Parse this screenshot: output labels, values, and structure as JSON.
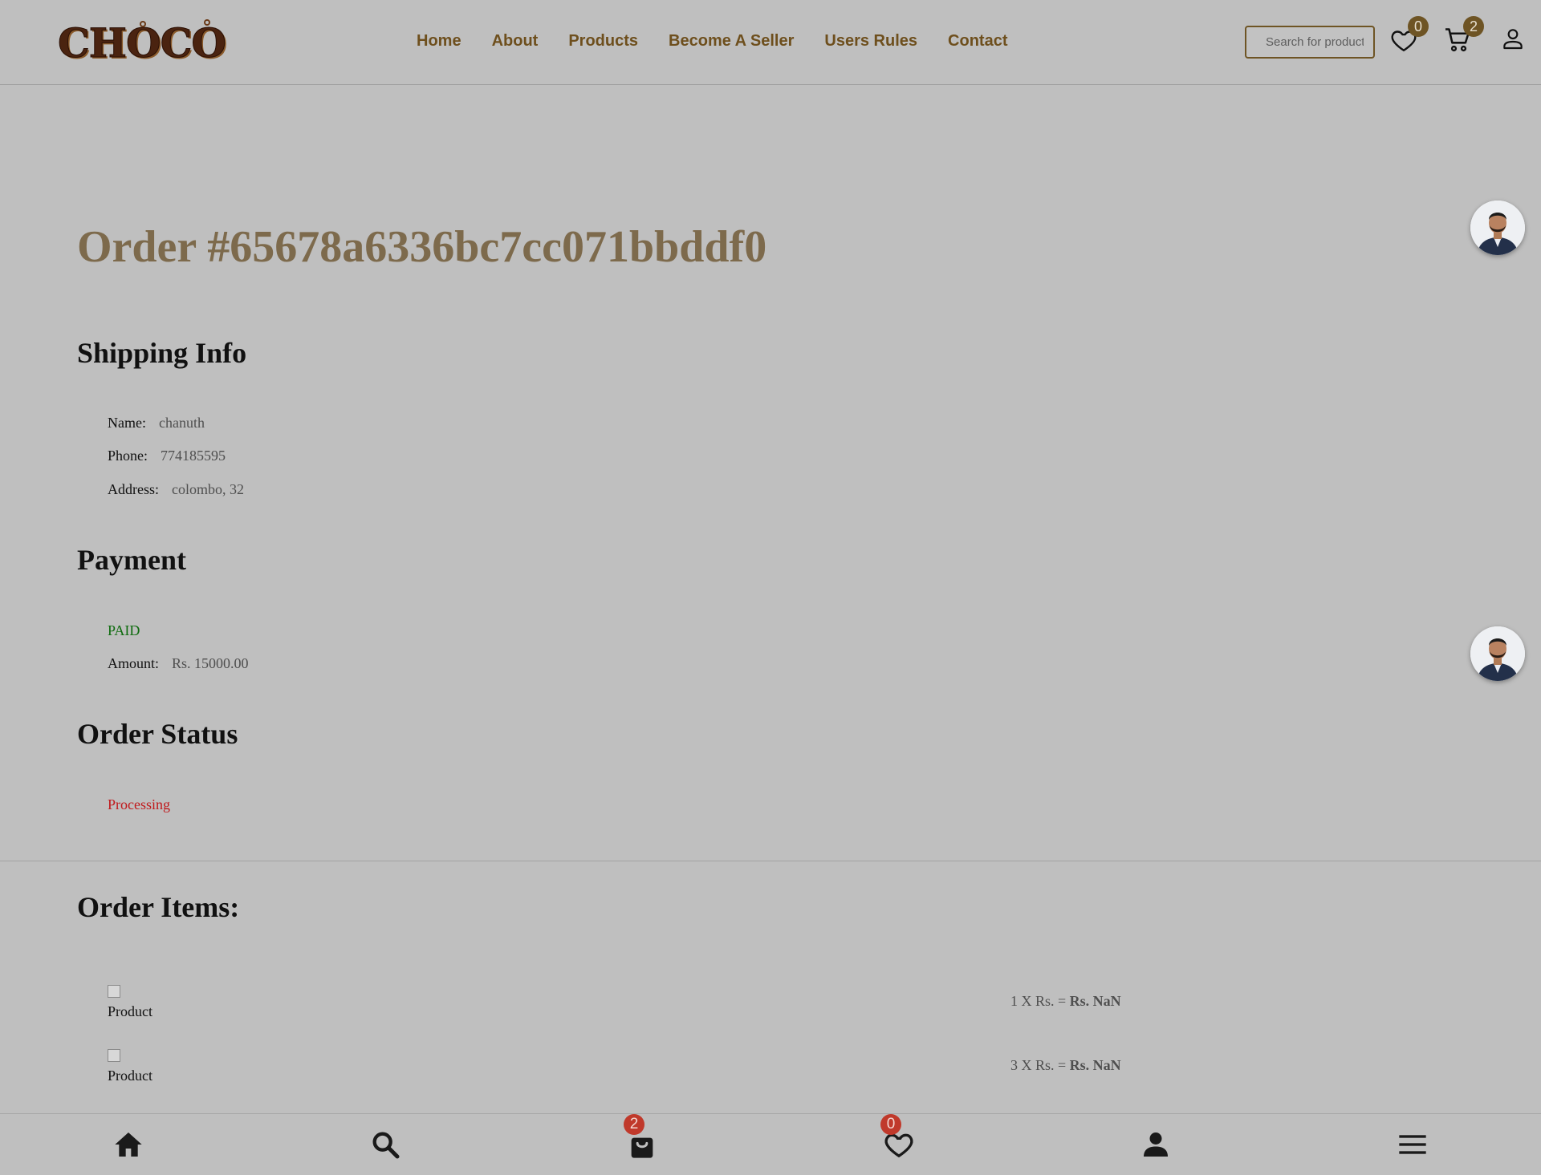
{
  "header": {
    "logo_text": "CHOCO",
    "nav": [
      "Home",
      "About",
      "Products",
      "Become A Seller",
      "Users Rules",
      "Contact"
    ],
    "search_placeholder": "Search for products",
    "wishlist_count": "0",
    "cart_count": "2",
    "icons": [
      "heart-icon",
      "cart-icon",
      "user-icon"
    ]
  },
  "order": {
    "title": "Order #65678a6336bc7cc071bbddf0"
  },
  "shipping": {
    "title": "Shipping Info",
    "name_label": "Name:",
    "name_value": "chanuth",
    "phone_label": "Phone:",
    "phone_value": "774185595",
    "address_label": "Address:",
    "address_value": "colombo, 32"
  },
  "payment": {
    "title": "Payment",
    "status": "PAID",
    "amount_label": "Amount:",
    "amount_value": "Rs. 15000.00"
  },
  "order_status": {
    "title": "Order Status",
    "value": "Processing"
  },
  "order_items": {
    "title": "Order Items:",
    "items": [
      {
        "img_alt": "Product",
        "qty_text": "1 X Rs. = ",
        "total": "Rs. NaN"
      },
      {
        "img_alt": "Product",
        "qty_text": "3 X Rs. = ",
        "total": "Rs. NaN"
      }
    ]
  },
  "bottom_bar": {
    "cart_count": "2",
    "wishlist_count": "0",
    "icons": [
      "home-icon",
      "search-icon",
      "shopping-bag-icon",
      "heart-icon",
      "person-icon",
      "menu-icon"
    ]
  },
  "colors": {
    "accent": "#6e4f1d",
    "title": "#7d6a4c",
    "paid": "#0e6b0e",
    "processing": "#c0191c",
    "badge_red": "#c0392b",
    "background": "#bfbfbf"
  }
}
